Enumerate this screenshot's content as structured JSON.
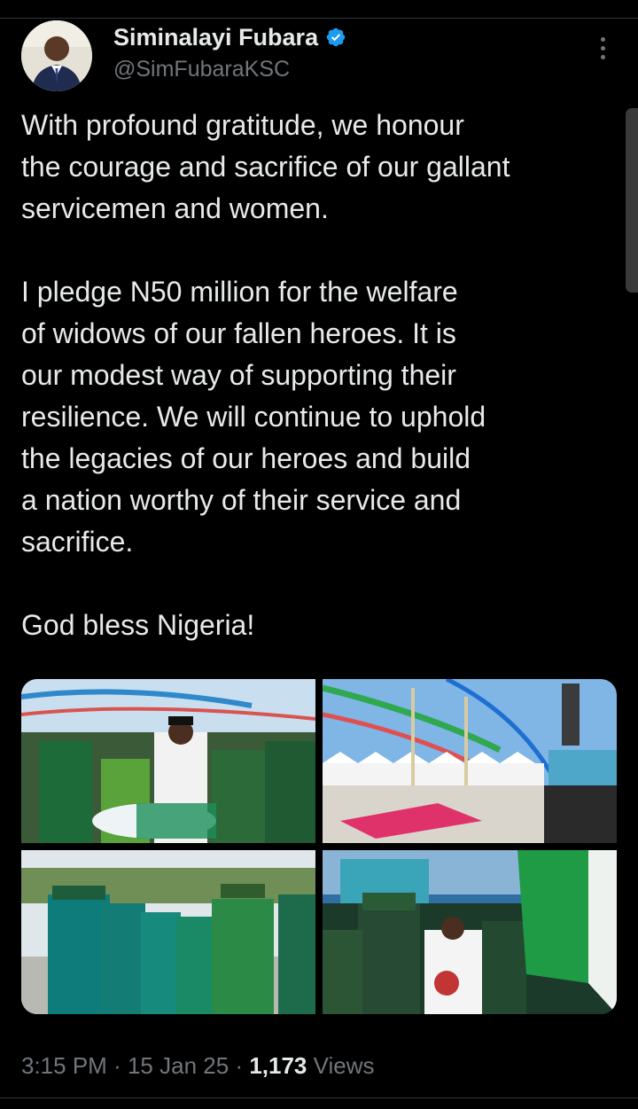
{
  "author": {
    "display_name": "Siminalayi Fubara",
    "handle": "@SimFubaraKSC",
    "verified_icon": "verified-badge-icon",
    "verified_color": "#1d9bf0"
  },
  "tweet": {
    "paragraphs": [
      "With profound gratitude, we honour\nthe courage and sacrifice of our gallant\nservicemen and women.",
      "I pledge N50 million for the welfare\nof widows of our fallen heroes. It is\nour modest way of supporting their\nresilience. We will continue to uphold\nthe legacies of our heroes and build\na nation worthy of their service and\nsacrifice.",
      " God bless Nigeria!"
    ]
  },
  "media": {
    "photo_count": 4,
    "photos": [
      {
        "name": "photo-governor-releasing-doves"
      },
      {
        "name": "photo-parade-ground-tents"
      },
      {
        "name": "photo-officers-in-green-uniforms"
      },
      {
        "name": "photo-governor-inspecting-guard"
      }
    ]
  },
  "meta": {
    "time": "3:15 PM",
    "separator": "·",
    "date": "15 Jan 25",
    "views_count": "1,173",
    "views_label": "Views"
  },
  "colors": {
    "background": "#000000",
    "text": "#e7e9ea",
    "secondary": "#71767b",
    "divider": "#2f3336"
  }
}
